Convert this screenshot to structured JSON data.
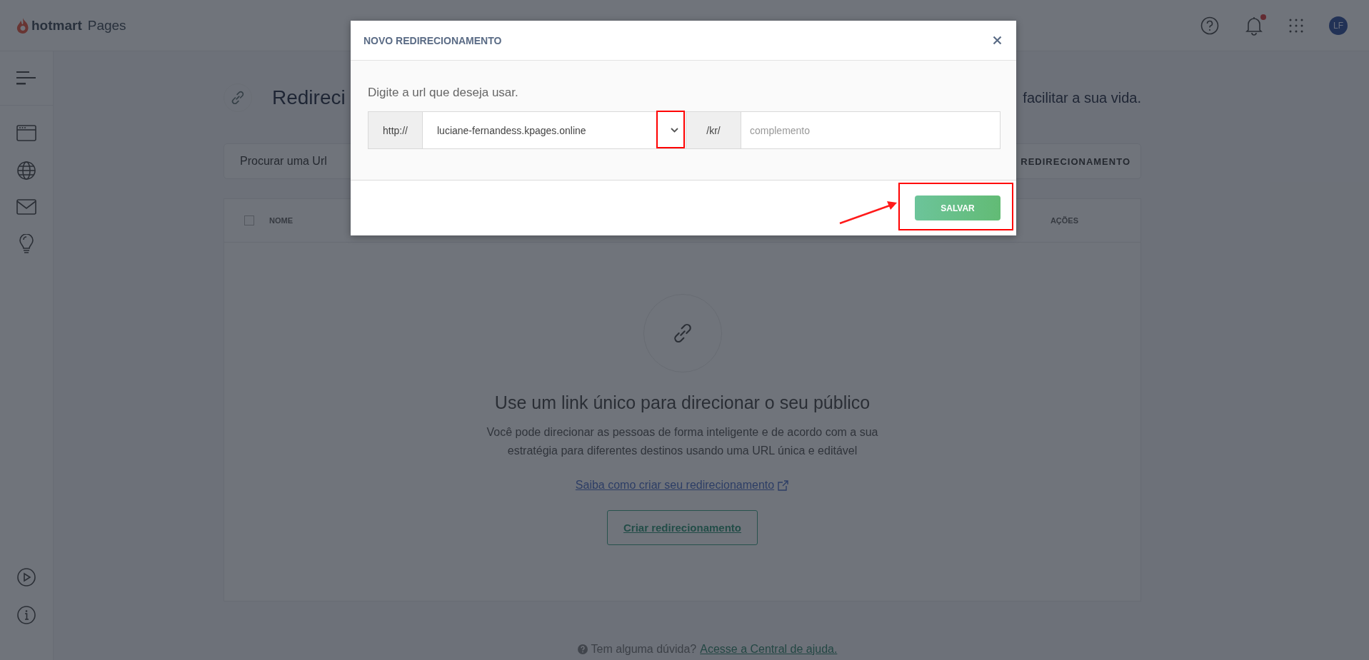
{
  "app_bar": {
    "brand": "hotmart",
    "product": "Pages",
    "unread_notifications": true,
    "avatar_initials": "LF"
  },
  "page": {
    "title_fragment": "Redireci",
    "subtitle_fragment": "facilitar a sua vida.",
    "search_placeholder": "Procurar uma Url",
    "new_button_fragment": "REDIRECIONAMENTO"
  },
  "table": {
    "select_all": {
      "checked": false
    },
    "columns": [
      "NOME",
      "AÇÕES"
    ]
  },
  "empty_state": {
    "heading": "Use um link único para direcionar o seu público",
    "description": "Você pode direcionar as pessoas de forma inteligente e de acordo com a sua estratégia para diferentes destinos usando uma URL única e editável",
    "help_link": "Saiba como criar seu redirecionamento",
    "create_button": "Criar redirecionamento"
  },
  "help": {
    "question": "Tem alguma dúvida?",
    "link": "Acesse a Central de ajuda."
  },
  "modal": {
    "title": "NOVO REDIRECIONAMENTO",
    "label": "Digite a url que deseja usar.",
    "protocol": "http://",
    "domain": "luciane-fernandess.kpages.online",
    "path_prefix": "/kr/",
    "path_placeholder": "complemento",
    "save_button": "SALVAR"
  }
}
